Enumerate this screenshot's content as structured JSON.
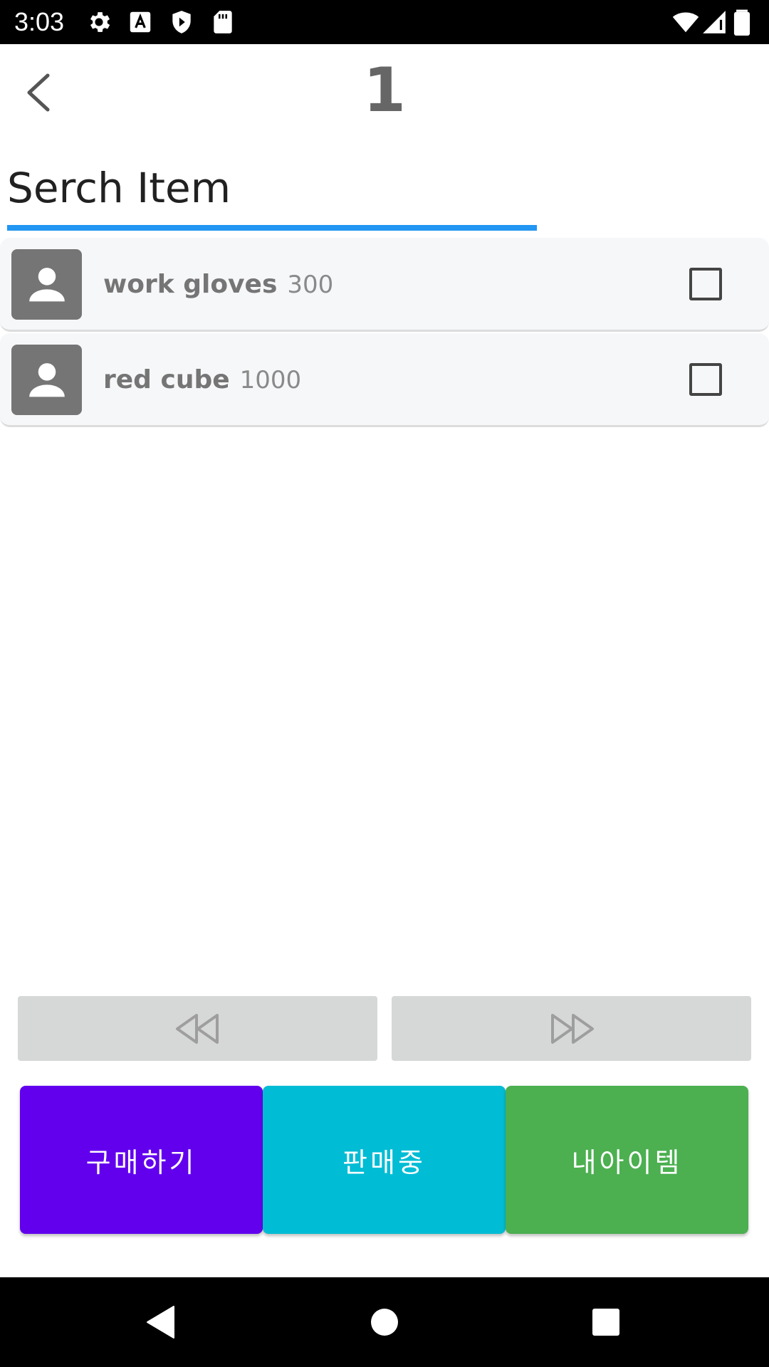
{
  "status_bar": {
    "time": "3:03",
    "left_icons": [
      "settings-icon",
      "text-a-icon",
      "shield-play-icon",
      "sd-card-icon"
    ],
    "right_icons": [
      "wifi-icon",
      "signal-icon",
      "battery-icon"
    ]
  },
  "header": {
    "page_number": "1",
    "back_icon": "chevron-left-icon"
  },
  "search": {
    "placeholder": "Serch Item",
    "value": "",
    "accent_color": "#2196F3"
  },
  "items": [
    {
      "name": "work gloves",
      "price": "300",
      "checked": false
    },
    {
      "name": "red cube",
      "price": "1000",
      "checked": false
    }
  ],
  "pager": {
    "prev_icon": "rewind-icon",
    "next_icon": "fast-forward-icon"
  },
  "tabs": [
    {
      "label": "구매하기",
      "color": "#6200EE"
    },
    {
      "label": "판매중",
      "color": "#00BCD4"
    },
    {
      "label": "내아이템",
      "color": "#4CAF50"
    }
  ],
  "nav_bar": {
    "icons": [
      "back-triangle-icon",
      "home-circle-icon",
      "recents-square-icon"
    ]
  }
}
